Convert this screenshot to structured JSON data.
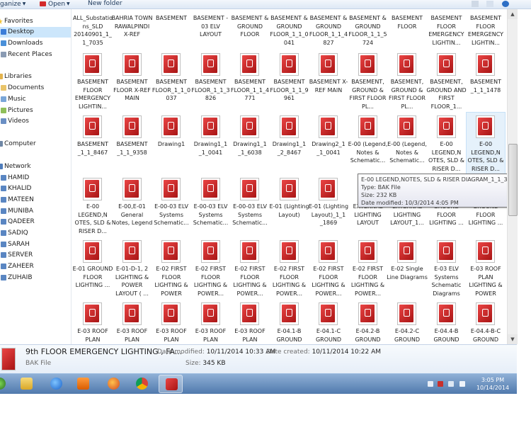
{
  "toolbar": {
    "organize_label": "ganize",
    "open_label": "Open",
    "new_folder_label": "New folder"
  },
  "nav": {
    "favorites": "Favorites",
    "desktop": "Desktop",
    "downloads": "Downloads",
    "recent": "Recent Places",
    "libraries": "Libraries",
    "documents": "Documents",
    "music": "Music",
    "pictures": "Pictures",
    "videos": "Videos",
    "computer": "Computer",
    "network": "Network",
    "computers": [
      "HAMID",
      "KHALID",
      "MATEEN",
      "MUNIBA",
      "QADEER",
      "SADIQ",
      "SARAH",
      "SERVER",
      "ZAHEER",
      "ZUHAIB"
    ]
  },
  "files": {
    "row0": [
      "ALL_Substations_SLD 20140901_1_1_7035",
      "BAHRIA TOWN RAWALPINDI X-REF",
      "BASEMENT",
      "BASEMENT - 03 ELV LAYOUT",
      "BASEMENT & GROUND FLOOR",
      "BASEMENT & GROUND FLOOR_1_1_0041",
      "BASEMENT & GROUND FLOOR_1_1_4827",
      "BASEMENT & GROUND FLOOR_1_1_5724",
      "BASEMENT FLOOR",
      "BASEMENT FLOOR EMERGENCY LIGHTIN...",
      "BASEMENT FLOOR EMERGENCY LIGHTIN..."
    ],
    "row1": [
      "BASEMENT FLOOR EMERGENCY LIGHTIN...",
      "BASEMENT FLOOR X-REF MAIN",
      "BASEMENT FLOOR_1_1_0037",
      "BASEMENT FLOOR_1_1_3826",
      "BASEMENT FLOOR_1_1_4771",
      "BASEMENT FLOOR_1_1_9961",
      "BASEMENT X-REF MAIN",
      "BASEMENT, GROUND & FIRST FLOOR PL...",
      "BASEMENT, GROUND & FIRST FLOOR PL...",
      "BASEMENT, GROUND AND FIRST FLOOR_1...",
      "BASEMENT _1_1_1478"
    ],
    "row2": [
      "BASEMENT _1_1_8467",
      "BASEMENT _1_1_9358",
      "Drawing1",
      "Drawing1_1 _1_0041",
      "Drawing1_1 _1_6038",
      "Drawing1_1 _2_8467",
      "Drawing2_1 _1_0041",
      "E-00 (Legend, Notes & Schematic...",
      "E-00 (Legend, Notes & Schematic...",
      "E-00 LEGEND,N OTES, SLD & RISER D...",
      "E-00 LEGEND,N OTES, SLD & RISER D..."
    ],
    "row3": [
      "E-00 LEGEND,N OTES, SLD & RISER D...",
      "E-00,E-01 General Notes, Legend",
      "E-00-03 ELV Systems Schematic...",
      "E-00-03 ELV Systems Schematic...",
      "E-00-03 ELV Systems Schematic...",
      "E-01 (Lighting Layout)",
      "E-01 (Lighting Layout)_1_1 _1869",
      "EXTERNAL LIGHTING LAYOUT",
      "EXTERNAL LIGHTING LAYOUT_1...",
      "GROUND FLOOR LIGHTING ...",
      "GROUND FLOOR LIGHTING ..."
    ],
    "row4": [
      "E-01 GROUND FLOOR LIGHTING ...",
      "E-01-D-1, 2 LIGHTING & POWER LAYOUT ( ...",
      "E-02 FIRST FLOOR LIGHTING & POWER",
      "E-02 FIRST FLOOR LIGHTING & POWER...",
      "E-02 FIRST FLOOR LIGHTING & POWER...",
      "E-02 FIRST FLOOR LIGHTING & POWER...",
      "E-02 FIRST FLOOR LIGHTING & POWER...",
      "E-02 FIRST FLOOR LIGHTING & POWER...",
      "E-02 Single Line Diagrams",
      "E-03 ELV Systems Schematic Diagrams",
      "E-03 ROOF PLAN LIGHTING & POWER"
    ],
    "row5": [
      "E-03 ROOF PLAN",
      "E-03 ROOF PLAN",
      "E-03 ROOF PLAN",
      "E-03 ROOF PLAN",
      "E-03 ROOF PLAN",
      "E-04.1-B GROUND",
      "E-04.1-C GROUND",
      "E-04.2-B GROUND",
      "E-04.2-C GROUND",
      "E-04.4-B GROUND",
      "E-04.4-B-C GROUND"
    ]
  },
  "tooltip": {
    "name": "E-00 LEGEND,NOTES, SLD & RISER DIAGRAM_1_1_3811",
    "type": "Type: BAK File",
    "size": "Size: 232 KB",
    "modified": "Date modified: 10/3/2014 4:05 PM"
  },
  "details": {
    "name": "9th FLOOR EMERGENCY LIGHTING , FA...",
    "modified_label": "Date modified:",
    "modified_value": "10/11/2014 10:33 AM",
    "created_label": "Date created:",
    "created_value": "10/11/2014 10:22 AM",
    "type": "BAK File",
    "size_label": "Size:",
    "size_value": "345 KB"
  },
  "clock": {
    "time": "3:05 PM",
    "date": "10/14/2014"
  },
  "icons": {
    "file": "autocad-bak-file-icon",
    "start": "windows-start-icon",
    "explorer": "folder-icon",
    "ie": "internet-explorer-icon",
    "media": "media-player-icon",
    "firefox": "firefox-icon",
    "chrome": "chrome-icon",
    "autocad": "autocad-icon"
  },
  "colors": {
    "accent": "#cce6fb",
    "file_red": "#c81e1e",
    "taskbar": "#5079ad"
  }
}
